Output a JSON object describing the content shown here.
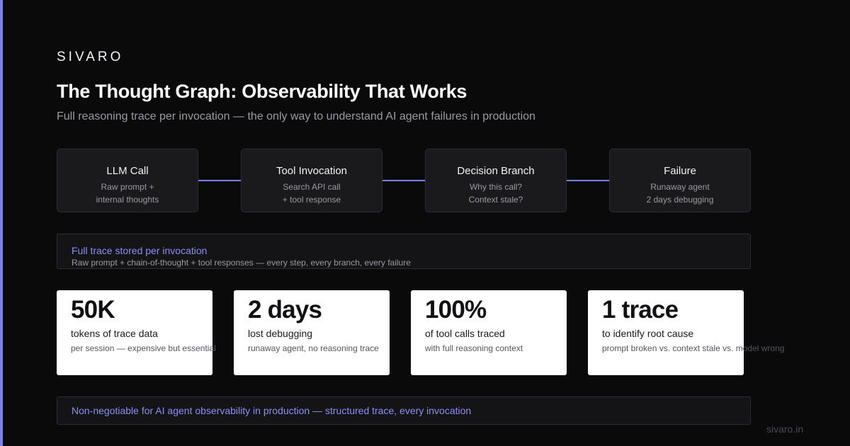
{
  "brand": "SIVARO",
  "title": "The Thought Graph: Observability That Works",
  "subtitle": "Full reasoning trace per invocation — the only way to understand AI agent failures in production",
  "flow": [
    {
      "title": "LLM Call",
      "line1": "Raw prompt +",
      "line2": "internal thoughts"
    },
    {
      "title": "Tool Invocation",
      "line1": "Search API call",
      "line2": "+ tool response"
    },
    {
      "title": "Decision Branch",
      "line1": "Why this call?",
      "line2": "Context stale?"
    },
    {
      "title": "Failure",
      "line1": "Runaway agent",
      "line2": "2 days debugging"
    }
  ],
  "trace_panel": {
    "title": "Full trace stored per invocation",
    "description": "Raw prompt + chain-of-thought + tool responses — every step, every branch, every failure"
  },
  "stats": [
    {
      "value": "50K",
      "label": "tokens of trace data",
      "note": "per session — expensive but essential"
    },
    {
      "value": "2 days",
      "label": "lost debugging",
      "note": "runaway agent, no reasoning trace"
    },
    {
      "value": "100%",
      "label": "of tool calls traced",
      "note": "with full reasoning context"
    },
    {
      "value": "1 trace",
      "label": "to identify root cause",
      "note": "prompt broken vs. context stale vs. model wrong"
    }
  ],
  "footer_note": "Non-negotiable for AI agent observability in production — structured trace, every invocation",
  "site": "sivaro.in",
  "colors": {
    "background": "#0a0a0b",
    "accent": "#7b7ff0",
    "card": "#ffffff",
    "node": "#1a1a1d"
  }
}
